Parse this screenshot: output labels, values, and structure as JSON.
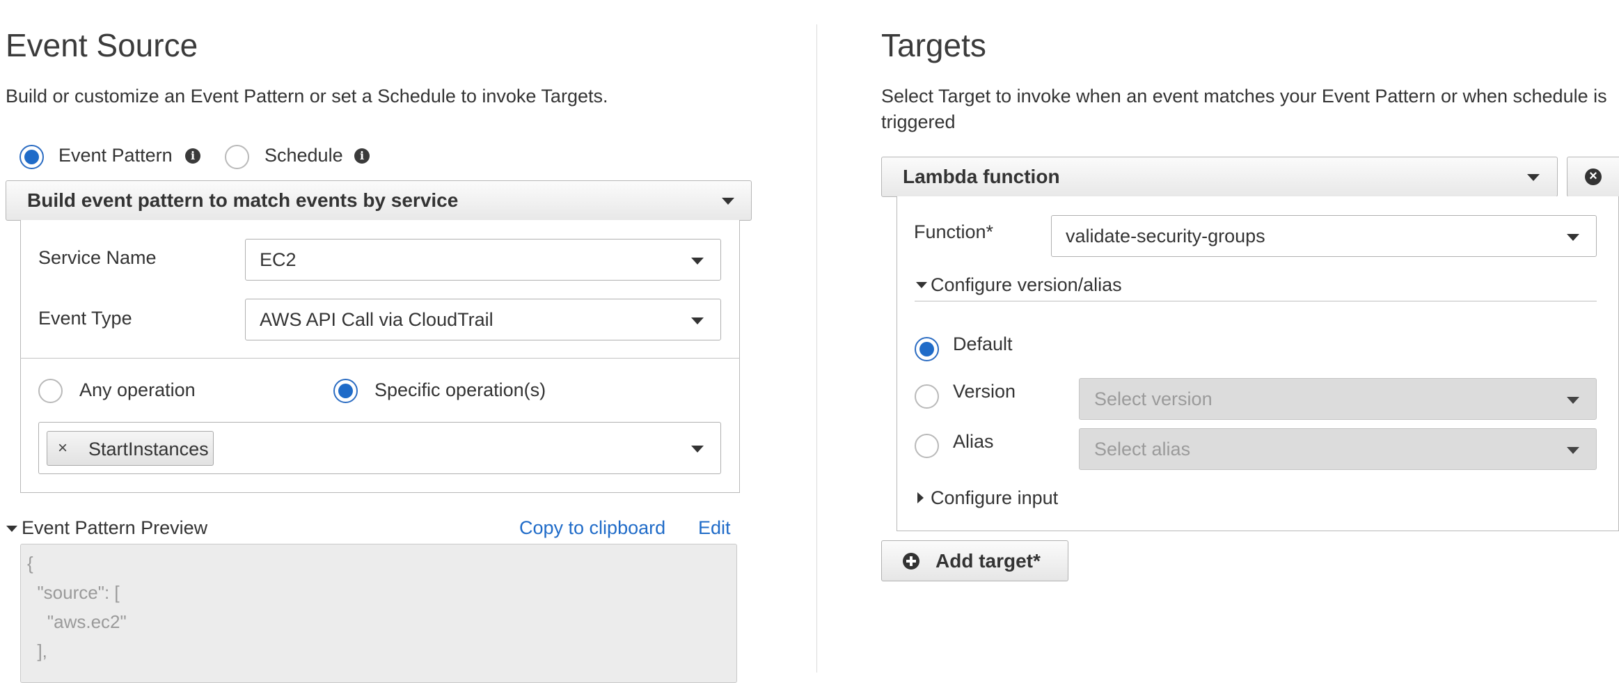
{
  "event_source": {
    "title": "Event Source",
    "description": "Build or customize an Event Pattern or set a Schedule to invoke Targets.",
    "mode_options": {
      "event_pattern": "Event Pattern",
      "schedule": "Schedule",
      "selected": "Event Pattern"
    },
    "builder_dropdown": "Build event pattern to match events by service",
    "service_name": {
      "label": "Service Name",
      "value": "EC2"
    },
    "event_type": {
      "label": "Event Type",
      "value": "AWS API Call via CloudTrail"
    },
    "operation": {
      "any_label": "Any operation",
      "specific_label": "Specific operation(s)",
      "selected": "Specific operation(s)",
      "tokens": [
        {
          "remove": "×",
          "label": "StartInstances"
        }
      ]
    },
    "preview": {
      "title": "Event Pattern Preview",
      "copy_link": "Copy to clipboard",
      "edit_link": "Edit",
      "lines": [
        "{",
        "  \"source\": [",
        "    \"aws.ec2\"",
        "  ],"
      ]
    }
  },
  "targets": {
    "title": "Targets",
    "description": "Select Target to invoke when an event matches your Event Pattern or when schedule is triggered",
    "target_type": "Lambda function",
    "function": {
      "label": "Function*",
      "value": "validate-security-groups"
    },
    "configure_version_alias": "Configure version/alias",
    "version_options": {
      "default_label": "Default",
      "version_label": "Version",
      "version_placeholder": "Select version",
      "alias_label": "Alias",
      "alias_placeholder": "Select alias",
      "selected": "Default"
    },
    "configure_input": "Configure input",
    "add_target": "Add target*"
  },
  "colors": {
    "accent_blue": "#1f6bc8",
    "disabled_field": "#dcdcdc",
    "code_text": "#9a9a9a"
  }
}
